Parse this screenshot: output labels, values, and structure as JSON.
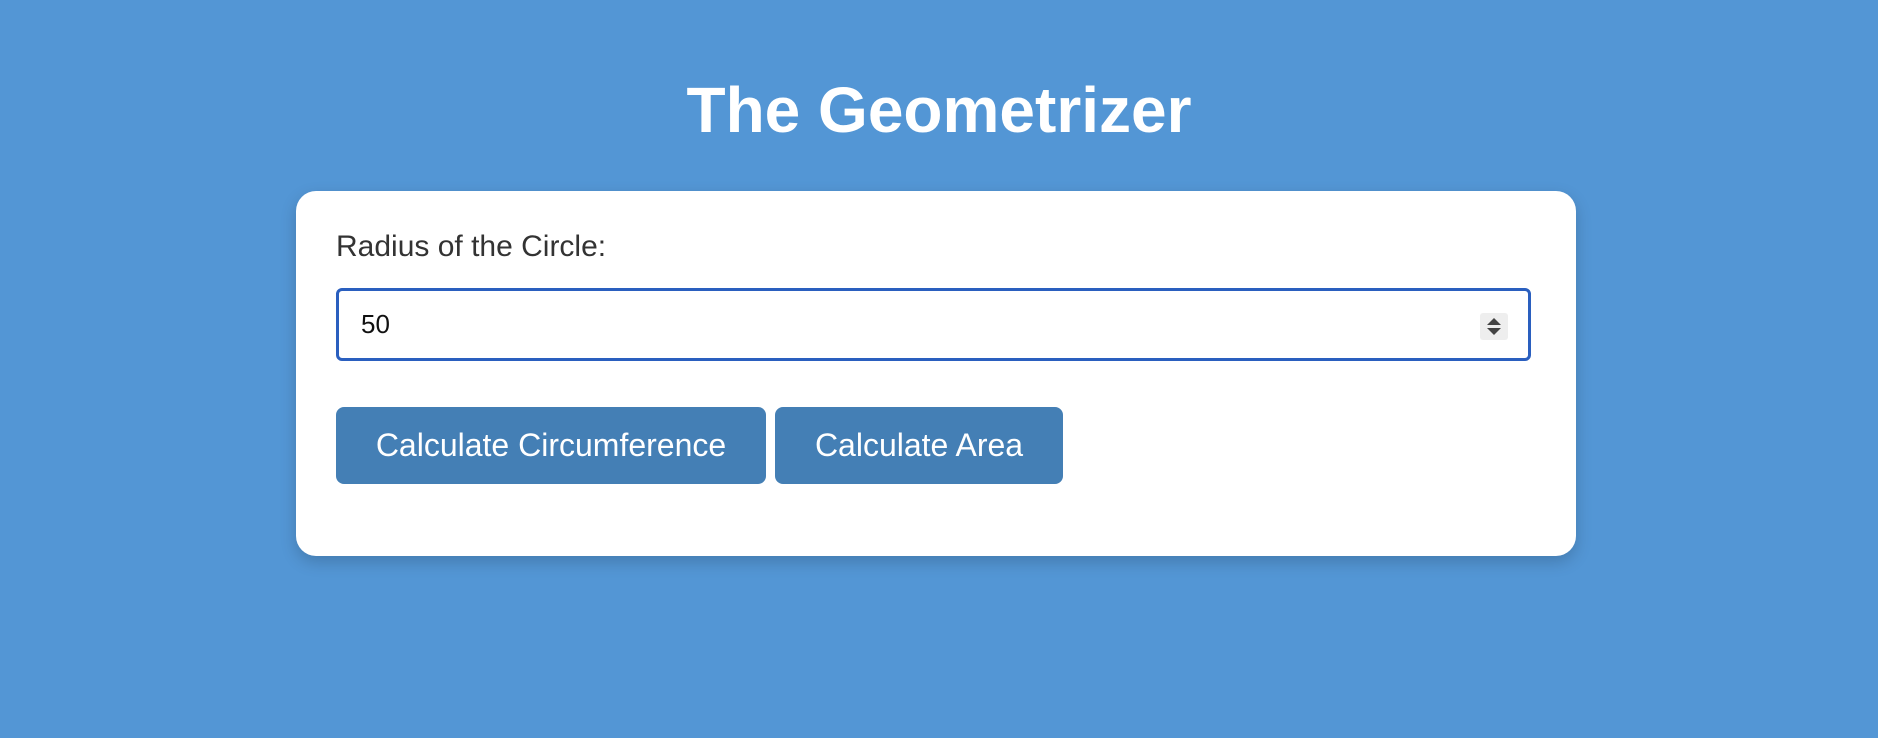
{
  "page": {
    "title": "The Geometrizer"
  },
  "form": {
    "radius_label": "Radius of the Circle:",
    "radius_value": "50"
  },
  "actions": {
    "circumference_label": "Calculate Circumference",
    "area_label": "Calculate Area"
  },
  "colors": {
    "background": "#5396d5",
    "button": "#447fb5",
    "input_focus_border": "#2a5fbf"
  },
  "icons": {
    "spinner": "number-spinner-icon"
  }
}
